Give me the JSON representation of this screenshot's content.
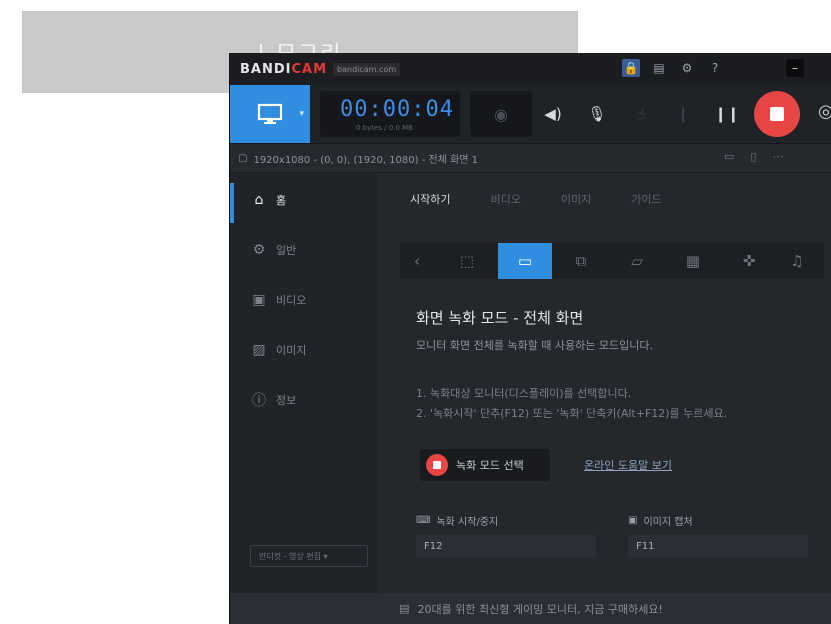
{
  "behind_window": {
    "title": "| 모그리"
  },
  "window": {
    "logo_main": "BANDI",
    "logo_accent": "CAM",
    "logo_sub": "bandicam.com",
    "titlebar_icons": [
      "lock-icon",
      "folder-icon",
      "gear-icon",
      "help-icon",
      "minimize-icon"
    ]
  },
  "toolbar": {
    "timer": "00:00:04",
    "timer_sub": "0 bytes / 0.0 MB",
    "mode_icon": "monitor-icon"
  },
  "statusbar": {
    "text": "1920x1080 - (0, 0), (1920, 1080) - 전체 화면 1"
  },
  "sidebar": {
    "items": [
      {
        "label": "홈",
        "icon": "home-icon"
      },
      {
        "label": "일반",
        "icon": "gear-icon"
      },
      {
        "label": "비디오",
        "icon": "video-icon"
      },
      {
        "label": "이미지",
        "icon": "image-icon"
      },
      {
        "label": "정보",
        "icon": "info-icon"
      }
    ],
    "footer": "반디컷 - 영상 편집 ▾"
  },
  "main": {
    "tabs": [
      "시작하기",
      "비디오",
      "이미지",
      "가이드"
    ],
    "modes": [
      "back",
      "rectangle",
      "fullscreen",
      "around-mouse",
      "device",
      "game",
      "gamepad",
      "audio"
    ],
    "section_title": "화면 녹화 모드 - 전체 화면",
    "description": "모니터 화면 전체를 녹화할 때 사용하는 모드입니다.",
    "steps": [
      "1. 녹화대상 모니터(디스플레이)를 선택합니다.",
      "2. '녹화시작' 단추(F12) 또는 '녹화' 단축키(Alt+F12)를 누르세요."
    ],
    "start_button": "녹화 모드 선택",
    "help_link": "온라인 도움말 보기",
    "options": [
      {
        "label": "녹화 시작/중지",
        "value": "F12"
      },
      {
        "label": "이미지 캡처",
        "value": "F11"
      }
    ]
  },
  "banner": {
    "text": "20대를 위한 최신형 게이밍 모니터, 지금 구매하세요!"
  }
}
